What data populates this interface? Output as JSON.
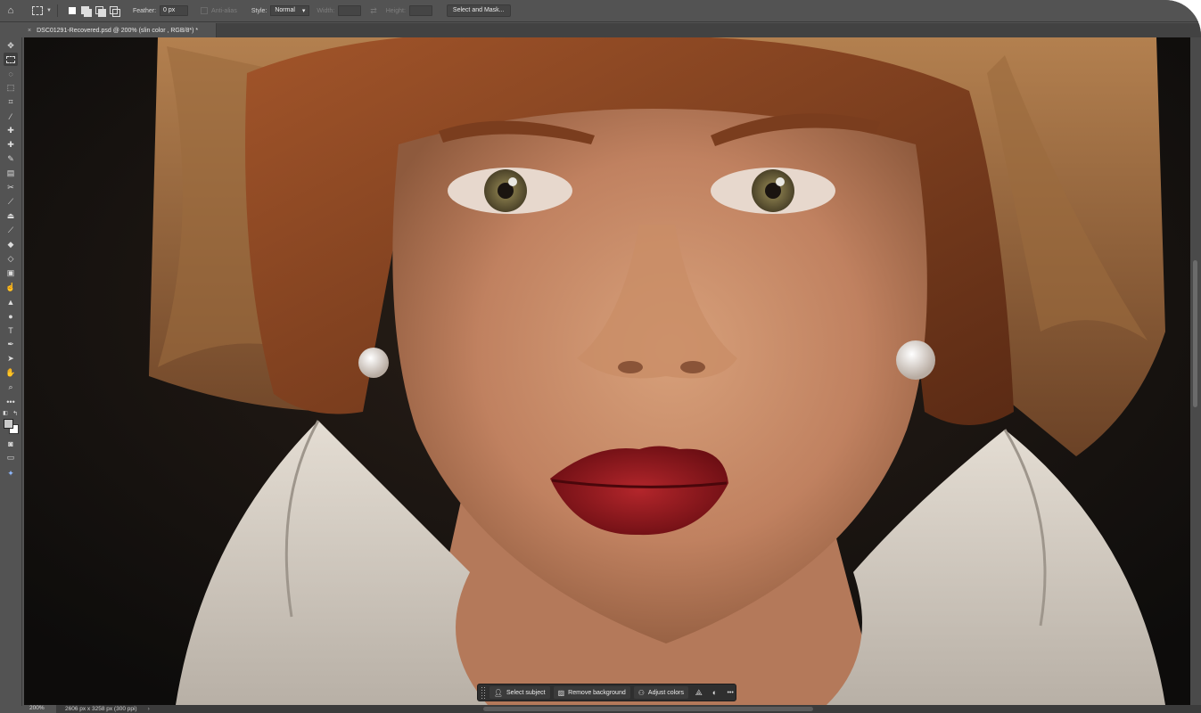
{
  "options_bar": {
    "feather_label": "Feather:",
    "feather_value": "0 px",
    "anti_alias_label": "Anti-alias",
    "style_label": "Style:",
    "style_value": "Normal",
    "width_label": "Width:",
    "height_label": "Height:",
    "select_mask_label": "Select and Mask..."
  },
  "document_tab": {
    "title": "DSC01291-Recovered.psd @ 200% (slin color , RGB/8*) *",
    "close_glyph": "×"
  },
  "toolbar": {
    "tools": [
      "move",
      "rectangular-marquee",
      "lasso",
      "object-selection",
      "crop",
      "eyedropper",
      "spot-healing",
      "healing",
      "brush",
      "clone-stamp",
      "history-brush",
      "eraser",
      "gradient",
      "blur",
      "dodge",
      "pen",
      "type",
      "path-selection",
      "rectangle",
      "hand",
      "zoom",
      "edit-toolbar",
      "default-colors",
      "swap-colors",
      "quick-mask",
      "screen-mode",
      "generative"
    ],
    "foreground_color": "#c9c9c9",
    "background_color": "#ffffff"
  },
  "status_bar": {
    "zoom": "200%",
    "document_size": "2606 px x 3258 px (300 ppi)",
    "arrow": "›"
  },
  "contextual_taskbar": {
    "select_subject": "Select subject",
    "remove_background": "Remove background",
    "adjust_colors": "Adjust colors",
    "more": "•••"
  },
  "colors": {
    "panel": "#535353",
    "panel_dark": "#3b3b3b",
    "lip": "#9c1a1f",
    "hair": "#8f4a23"
  }
}
